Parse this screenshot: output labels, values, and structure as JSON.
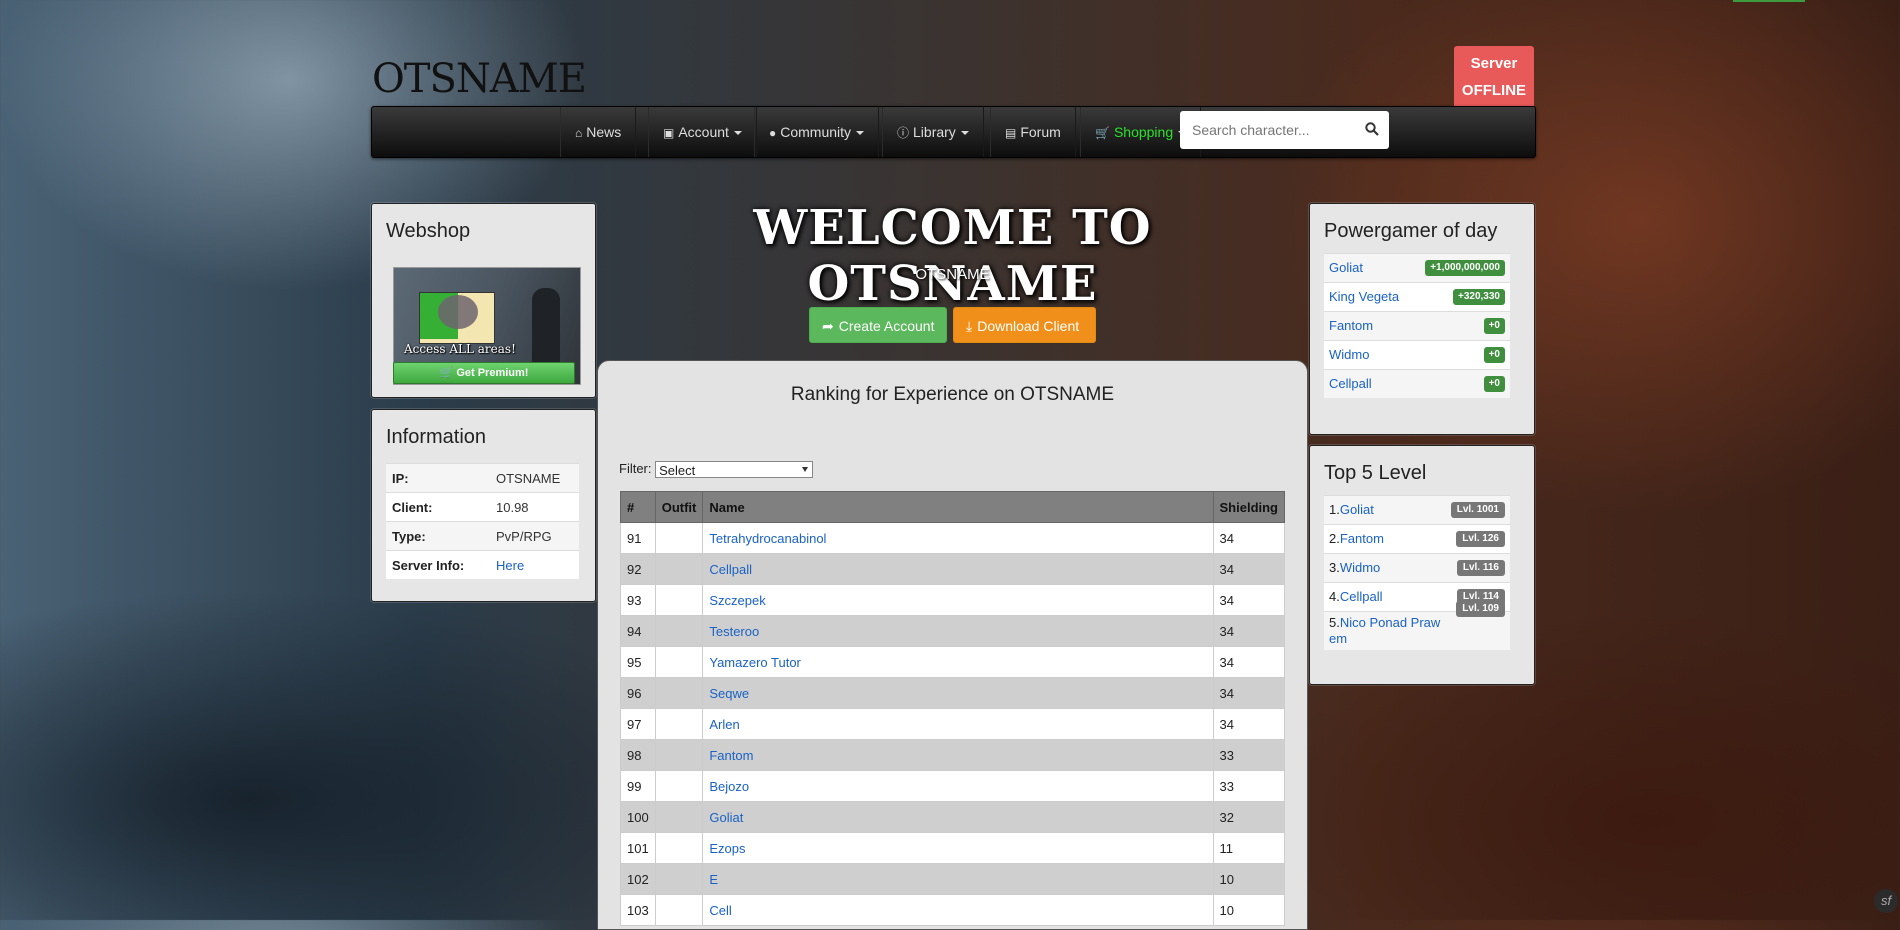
{
  "header": {
    "logo": "OTSNAME",
    "server_status": {
      "line1": "Server",
      "line2": "OFFLINE"
    }
  },
  "nav": {
    "items": [
      {
        "label": "News",
        "icon": "home-icon"
      },
      {
        "label": "Account",
        "icon": "lock-icon"
      },
      {
        "label": "Community",
        "icon": "user-icon"
      },
      {
        "label": "Library",
        "icon": "info-icon"
      },
      {
        "label": "Forum",
        "icon": "list-icon"
      },
      {
        "label": "Shopping",
        "icon": "cart-icon"
      }
    ],
    "search_placeholder": "Search character..."
  },
  "webshop": {
    "title": "Webshop",
    "banner_text": "Access ALL areas!",
    "button_label": "Get Premium!"
  },
  "information": {
    "title": "Information",
    "rows": [
      {
        "key": "IP:",
        "value": "OTSNAME"
      },
      {
        "key": "Client:",
        "value": "10.98"
      },
      {
        "key": "Type:",
        "value": "PvP/RPG"
      },
      {
        "key": "Server Info:",
        "value": "Here"
      }
    ]
  },
  "main": {
    "welcome": "WELCOME TO OTSNAME",
    "subtitle": "OTSNAME",
    "create_account": "Create Account",
    "download_client": "Download Client",
    "ranking_title": "Ranking for Experience on OTSNAME",
    "filter_label": "Filter:",
    "filter_value": "Select",
    "columns": [
      "#",
      "Outfit",
      "Name",
      "Shielding"
    ],
    "rows": [
      {
        "rank": "91",
        "name": "Tetrahydrocanabinol",
        "value": "34"
      },
      {
        "rank": "92",
        "name": "Cellpall",
        "value": "34"
      },
      {
        "rank": "93",
        "name": "Szczepek",
        "value": "34"
      },
      {
        "rank": "94",
        "name": "Testeroo",
        "value": "34"
      },
      {
        "rank": "95",
        "name": "Yamazero Tutor",
        "value": "34"
      },
      {
        "rank": "96",
        "name": "Seqwe",
        "value": "34"
      },
      {
        "rank": "97",
        "name": "Arlen",
        "value": "34"
      },
      {
        "rank": "98",
        "name": "Fantom",
        "value": "33"
      },
      {
        "rank": "99",
        "name": "Bejozo",
        "value": "33"
      },
      {
        "rank": "100",
        "name": "Goliat",
        "value": "32"
      },
      {
        "rank": "101",
        "name": "Ezops",
        "value": "11"
      },
      {
        "rank": "102",
        "name": "E",
        "value": "10"
      },
      {
        "rank": "103",
        "name": "Cell",
        "value": "10"
      }
    ]
  },
  "powergamer": {
    "title": "Powergamer of day",
    "rows": [
      {
        "name": "Goliat",
        "value": "+1,000,000,000"
      },
      {
        "name": "King Vegeta",
        "value": "+320,330"
      },
      {
        "name": "Fantom",
        "value": "+0"
      },
      {
        "name": "Widmo",
        "value": "+0"
      },
      {
        "name": "Cellpall",
        "value": "+0"
      }
    ]
  },
  "top5": {
    "title": "Top 5 Level",
    "rows": [
      {
        "pos": "1.",
        "name": "Goliat",
        "level": "Lvl. 1001"
      },
      {
        "pos": "2.",
        "name": "Fantom",
        "level": "Lvl. 126"
      },
      {
        "pos": "3.",
        "name": "Widmo",
        "level": "Lvl. 116"
      },
      {
        "pos": "4.",
        "name": "Cellpall",
        "level": "Lvl. 114"
      },
      {
        "pos": "5.",
        "name": "Nico Ponad Praw em",
        "level": "Lvl. 109"
      }
    ]
  },
  "colors": {
    "server_offline": "#e85a5a",
    "create_btn": "#5cb85c",
    "download_btn": "#f0901a",
    "shopping": "#2be22b",
    "link": "#1a62c4"
  }
}
